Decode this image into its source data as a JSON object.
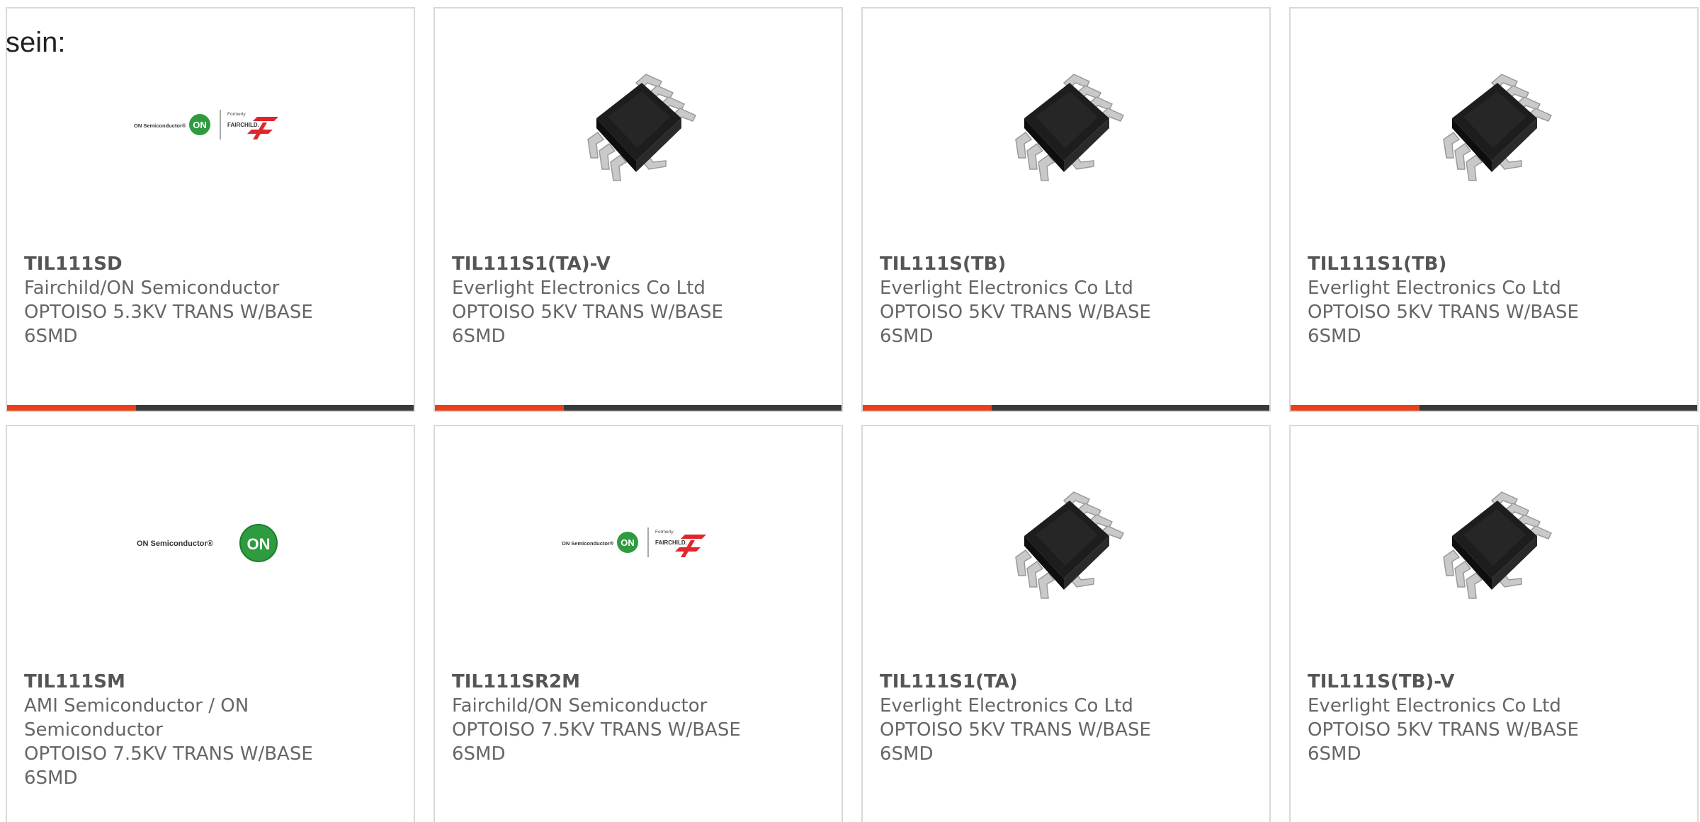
{
  "intro_text": "sein:",
  "products": [
    {
      "part": "TIL111SD",
      "manufacturer_lines": [
        "Fairchild/ON Semiconductor"
      ],
      "description_lines": [
        "OPTOISO 5.3KV TRANS W/BASE",
        "6SMD"
      ],
      "image": "onsemi-fairchild-logo",
      "logo_text": {
        "left": "ON Semiconductor®",
        "badge": "ON",
        "formerly": "Formerly",
        "brand": "FAIRCHILD."
      }
    },
    {
      "part": "TIL111S1(TA)-V",
      "manufacturer_lines": [
        "Everlight Electronics Co Ltd"
      ],
      "description_lines": [
        "OPTOISO 5KV TRANS W/BASE",
        "6SMD"
      ],
      "image": "smd-chip-icon"
    },
    {
      "part": "TIL111S(TB)",
      "manufacturer_lines": [
        "Everlight Electronics Co Ltd"
      ],
      "description_lines": [
        "OPTOISO 5KV TRANS W/BASE",
        "6SMD"
      ],
      "image": "smd-chip-icon"
    },
    {
      "part": "TIL111S1(TB)",
      "manufacturer_lines": [
        "Everlight Electronics Co Ltd"
      ],
      "description_lines": [
        "OPTOISO 5KV TRANS W/BASE",
        "6SMD"
      ],
      "image": "smd-chip-icon"
    },
    {
      "part": "TIL111SM",
      "manufacturer_lines": [
        "AMI Semiconductor / ON",
        "Semiconductor"
      ],
      "description_lines": [
        "OPTOISO 7.5KV TRANS W/BASE",
        "6SMD"
      ],
      "image": "onsemi-logo",
      "logo_text": {
        "left": "ON Semiconductor®",
        "badge": "ON"
      }
    },
    {
      "part": "TIL111SR2M",
      "manufacturer_lines": [
        "Fairchild/ON Semiconductor"
      ],
      "description_lines": [
        "OPTOISO 7.5KV TRANS W/BASE",
        "6SMD"
      ],
      "image": "onsemi-fairchild-logo",
      "logo_text": {
        "left": "ON Semiconductor®",
        "badge": "ON",
        "formerly": "Formerly",
        "brand": "FAIRCHILD."
      }
    },
    {
      "part": "TIL111S1(TA)",
      "manufacturer_lines": [
        "Everlight Electronics Co Ltd"
      ],
      "description_lines": [
        "OPTOISO 5KV TRANS W/BASE",
        "6SMD"
      ],
      "image": "smd-chip-icon"
    },
    {
      "part": "TIL111S(TB)-V",
      "manufacturer_lines": [
        "Everlight Electronics Co Ltd"
      ],
      "description_lines": [
        "OPTOISO 5KV TRANS W/BASE",
        "6SMD"
      ],
      "image": "smd-chip-icon"
    }
  ],
  "colors": {
    "accent": "#e8401c",
    "bar_dark": "#3a3a3a",
    "card_border": "#d9d9d9",
    "on_green": "#2e9b3f",
    "fairchild_red": "#e0262b"
  }
}
